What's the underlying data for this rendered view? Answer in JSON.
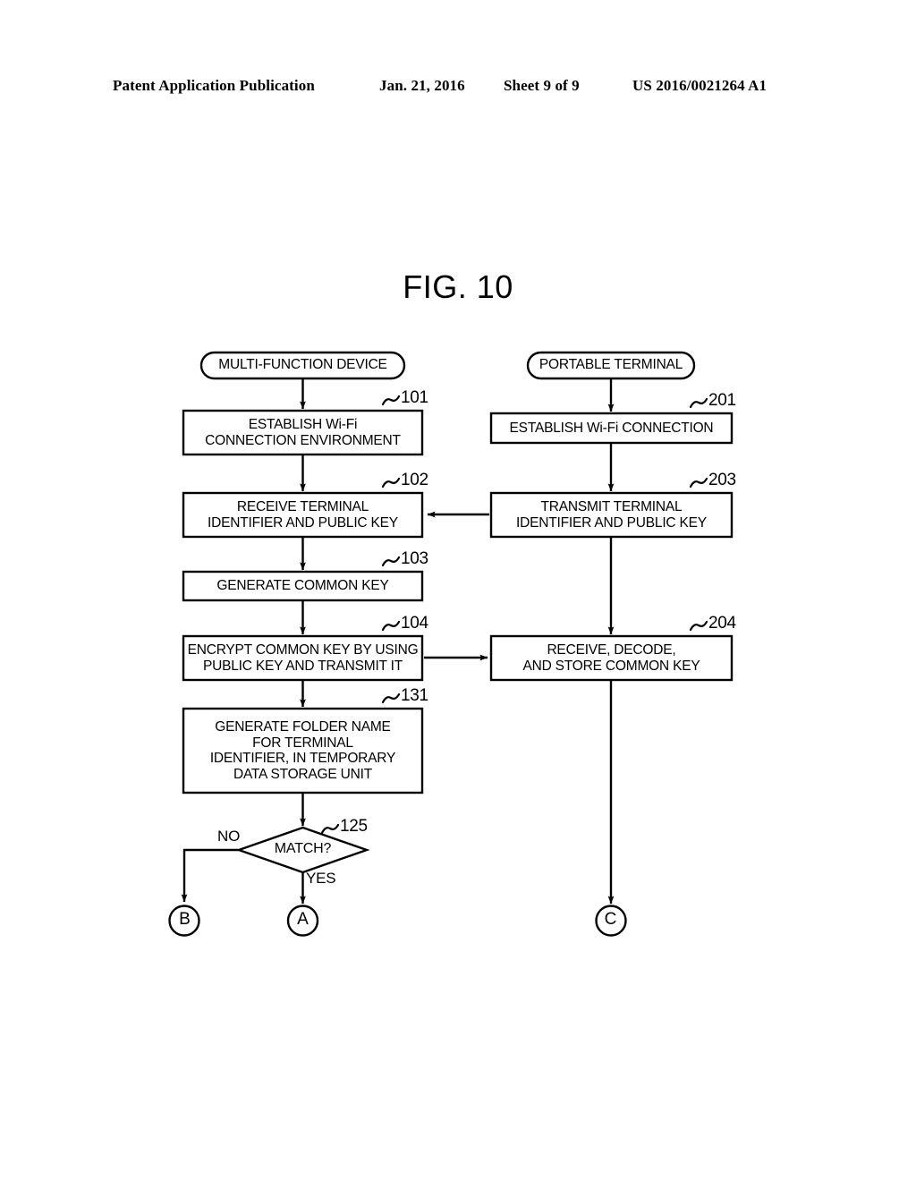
{
  "header": {
    "publication": "Patent Application Publication",
    "date": "Jan. 21, 2016",
    "sheet": "Sheet 9 of 9",
    "patent_number": "US 2016/0021264 A1"
  },
  "figure": {
    "title": "FIG. 10",
    "lanes": [
      {
        "id": "lane-device",
        "label": "MULTI-FUNCTION DEVICE"
      },
      {
        "id": "lane-terminal",
        "label": "PORTABLE TERMINAL"
      }
    ],
    "nodes": [
      {
        "id": "node-101",
        "ref": "101",
        "lane": "device",
        "shape": "process",
        "label": "ESTABLISH Wi-Fi\nCONNECTION ENVIRONMENT"
      },
      {
        "id": "node-102",
        "ref": "102",
        "lane": "device",
        "shape": "process",
        "label": "RECEIVE TERMINAL\nIDENTIFIER AND PUBLIC KEY"
      },
      {
        "id": "node-103",
        "ref": "103",
        "lane": "device",
        "shape": "process",
        "label": "GENERATE COMMON KEY"
      },
      {
        "id": "node-104",
        "ref": "104",
        "lane": "device",
        "shape": "process",
        "label": "ENCRYPT COMMON KEY BY USING\nPUBLIC KEY AND TRANSMIT IT"
      },
      {
        "id": "node-131",
        "ref": "131",
        "lane": "device",
        "shape": "process",
        "label": "GENERATE FOLDER NAME\nFOR TERMINAL\nIDENTIFIER, IN TEMPORARY\nDATA STORAGE UNIT"
      },
      {
        "id": "node-125",
        "ref": "125",
        "lane": "device",
        "shape": "decision",
        "label": "MATCH?"
      },
      {
        "id": "node-201",
        "ref": "201",
        "lane": "terminal",
        "shape": "process",
        "label": "ESTABLISH Wi-Fi CONNECTION"
      },
      {
        "id": "node-203",
        "ref": "203",
        "lane": "terminal",
        "shape": "process",
        "label": "TRANSMIT TERMINAL\nIDENTIFIER AND PUBLIC KEY"
      },
      {
        "id": "node-204",
        "ref": "204",
        "lane": "terminal",
        "shape": "process",
        "label": "RECEIVE, DECODE,\nAND STORE COMMON KEY"
      }
    ],
    "branch_labels": [
      {
        "id": "branch-no",
        "label": "NO"
      },
      {
        "id": "branch-yes",
        "label": "YES"
      }
    ],
    "connectors": [
      {
        "id": "connector-b",
        "label": "B"
      },
      {
        "id": "connector-a",
        "label": "A"
      },
      {
        "id": "connector-c",
        "label": "C"
      }
    ],
    "colors": {
      "ink": "#000000",
      "background": "#ffffff"
    }
  }
}
